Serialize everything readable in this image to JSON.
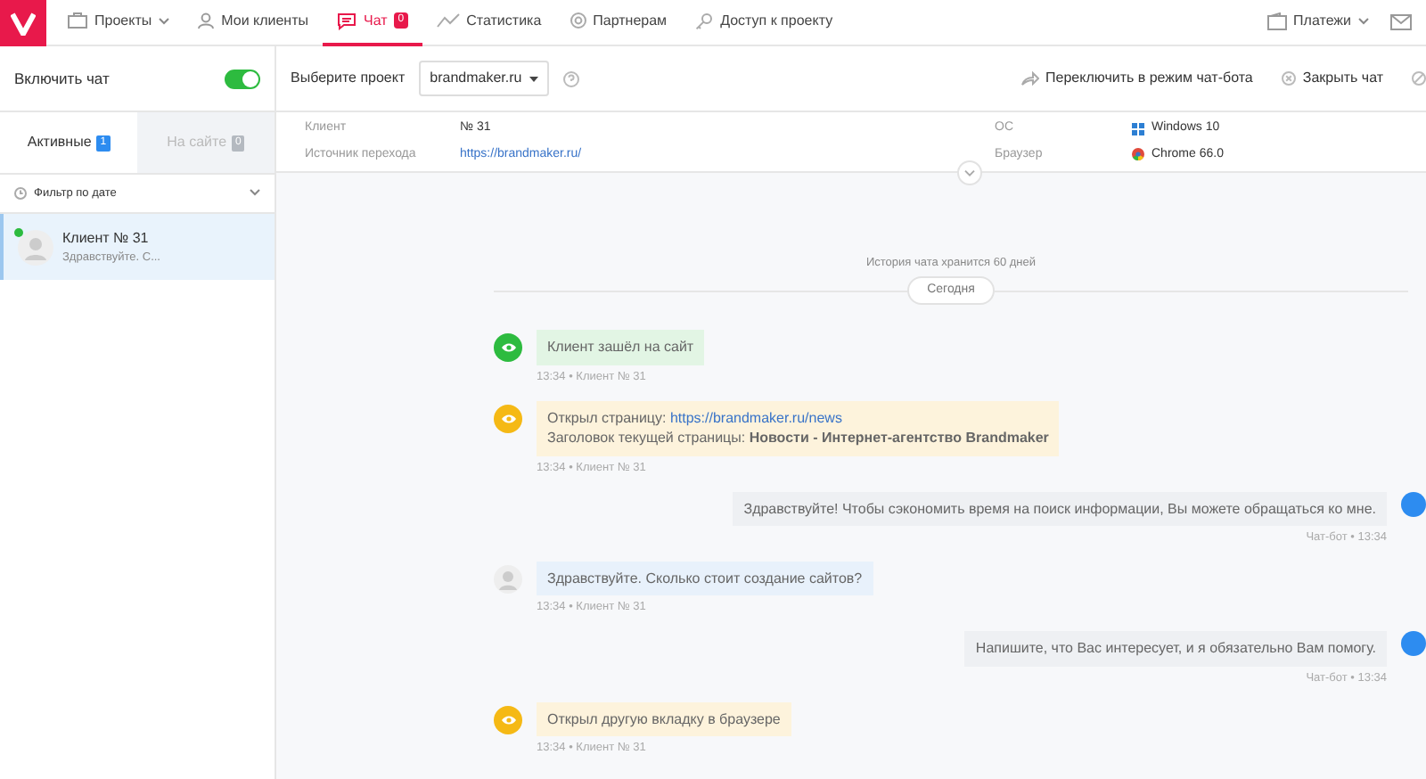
{
  "nav": {
    "items": [
      {
        "label": "Проекты",
        "caret": true,
        "selected": false
      },
      {
        "label": "Мои клиенты",
        "caret": false,
        "selected": false
      },
      {
        "label": "Чат",
        "badge": "0",
        "caret": false,
        "selected": true
      },
      {
        "label": "Статистика",
        "caret": false,
        "selected": false
      },
      {
        "label": "Партнерам",
        "caret": false,
        "selected": false
      },
      {
        "label": "Доступ к проекту",
        "caret": false,
        "selected": false
      }
    ],
    "payments": "Платежи"
  },
  "chat_toggle": {
    "label": "Включить чат",
    "on": true
  },
  "tabs": [
    {
      "label": "Активные",
      "badge": "1",
      "selected": true
    },
    {
      "label": "На сайте",
      "badge": "0",
      "selected": false
    }
  ],
  "filter": "Фильтр по дате",
  "clients": [
    {
      "name": "Клиент № 31",
      "preview": "Здравствуйте. С...",
      "online": true,
      "selected": true
    }
  ],
  "toolbar": {
    "project_label": "Выберите проект",
    "project": "brandmaker.ru",
    "switch_bot": "Переключить в режим чат-бота",
    "close_chat": "Закрыть чат"
  },
  "info": {
    "left": [
      {
        "label": "Клиент",
        "value": "№ 31",
        "kind": "text"
      },
      {
        "label": "Источник перехода",
        "value": "https://brandmaker.ru/",
        "kind": "link"
      }
    ],
    "right": [
      {
        "label": "ОС",
        "value": "Windows 10"
      },
      {
        "label": "Браузер",
        "value": "Chrome 66.0"
      }
    ]
  },
  "history_note": "История чата хранится 60 дней",
  "day": "Сегодня",
  "messages": [
    {
      "kind": "event",
      "color": "#2dbb3f",
      "text": "Клиент зашёл на сайт",
      "meta": "13:34 • Клиент № 31"
    },
    {
      "kind": "event",
      "color": "#f5b915",
      "text": "Открыл страницу: ",
      "link": "https://brandmaker.ru/news",
      "subtext": "Заголовок текущей страницы: **Новости - Интернет-агентство Brandmaker**",
      "meta": "13:34 • Клиент № 31"
    },
    {
      "kind": "outgoing",
      "text": "Здравствуйте! Чтобы сэкономить время на поиск информации, Вы можете обращаться ко мне.",
      "meta": "Чат-бот • 13:34"
    },
    {
      "kind": "incoming",
      "text": "Здравствуйте. Сколько стоит создание сайтов?",
      "meta": "13:34 • Клиент № 31"
    },
    {
      "kind": "outgoing",
      "text": "Напишите, что Вас интересует, и я обязательно Вам помогу.",
      "meta": "Чат-бот • 13:34"
    },
    {
      "kind": "event",
      "color": "#f5b915",
      "text": "Открыл другую вкладку в браузере",
      "meta": "13:34 • Клиент № 31"
    }
  ]
}
